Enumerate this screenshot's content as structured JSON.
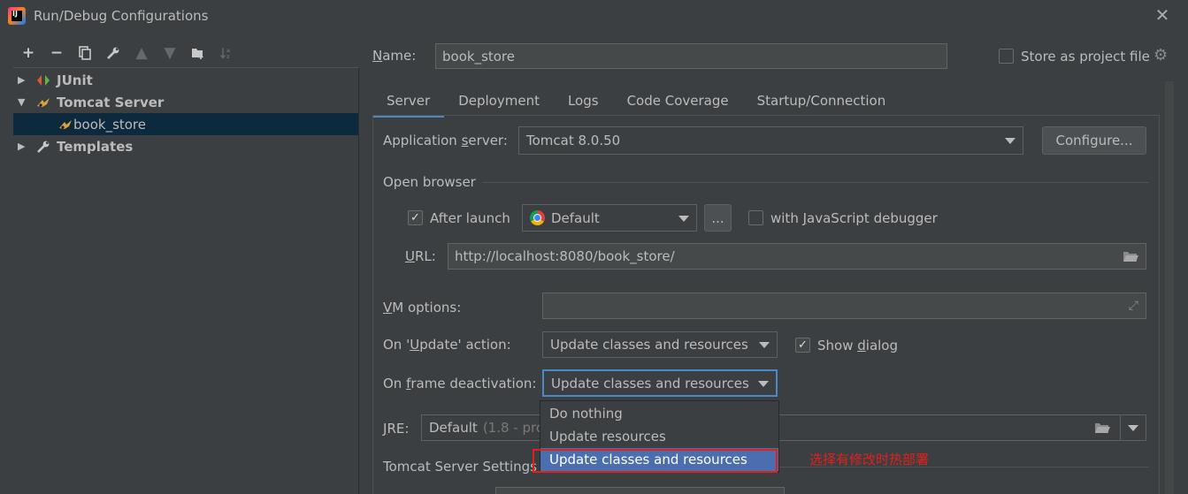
{
  "window": {
    "title": "Run/Debug Configurations"
  },
  "toolbar": {
    "icons": [
      "add-icon",
      "remove-icon",
      "copy-icon",
      "wrench-icon",
      "move-up-icon",
      "move-down-icon",
      "new-folder-icon",
      "sort-icon"
    ]
  },
  "tree": {
    "items": [
      {
        "label": "JUnit",
        "expanded": false,
        "icon": "junit-icon"
      },
      {
        "label": "Tomcat Server",
        "expanded": true,
        "icon": "tomcat-icon"
      },
      {
        "label": "book_store",
        "icon": "tomcat-icon",
        "selected": true
      },
      {
        "label": "Templates",
        "expanded": false,
        "icon": "wrench-icon"
      }
    ]
  },
  "config": {
    "name_label": "Name:",
    "name_value": "book_store",
    "store_as_project_file": "Store as project file",
    "tabs": [
      "Server",
      "Deployment",
      "Logs",
      "Code Coverage",
      "Startup/Connection"
    ],
    "active_tab": "Server",
    "app_server_label": "Application server:",
    "app_server_value": "Tomcat 8.0.50",
    "configure_button": "Configure...",
    "open_browser_label": "Open browser",
    "after_launch_label": "After launch",
    "browser_value": "Default",
    "browse_button": "...",
    "js_debugger_label": "with JavaScript debugger",
    "url_label": "URL:",
    "url_value": "http://localhost:8080/book_store/",
    "vm_options_label": "VM options:",
    "on_update_label": "On 'Update' action:",
    "on_update_value": "Update classes and resources",
    "show_dialog_label": "Show dialog",
    "on_frame_label": "On frame deactivation:",
    "on_frame_value": "Update classes and resources",
    "jre_label": "JRE:",
    "jre_value": "Default",
    "jre_hint": "(1.8 - pro",
    "tomcat_settings_label": "Tomcat Server Settings"
  },
  "dropdown": {
    "options": [
      "Do nothing",
      "Update resources",
      "Update classes and resources"
    ],
    "selected": "Update classes and resources"
  },
  "annotation": {
    "text": "选择有修改时热部署",
    "color": "#e0211b"
  },
  "colors": {
    "background": "#3c3f41",
    "selection": "#0d293e",
    "dropdown_selection": "#4b6eaf",
    "tab_underline": "#4a88c7"
  }
}
